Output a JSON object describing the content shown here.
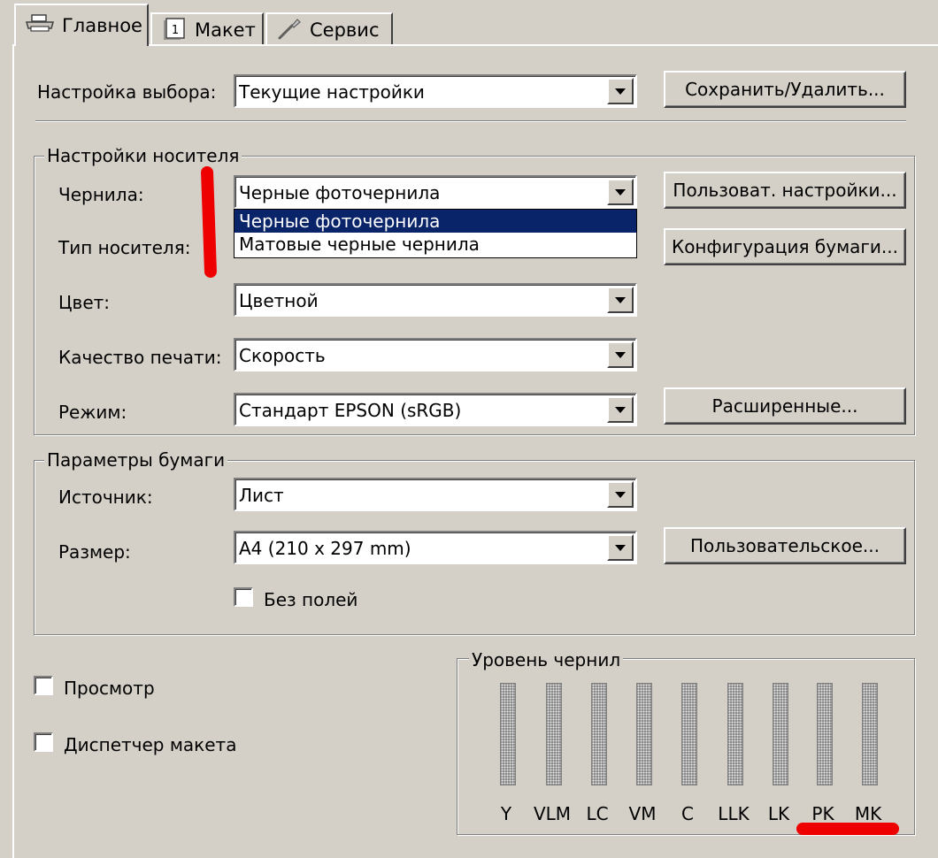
{
  "tabs": [
    {
      "label": "Главное",
      "icon": "printer-icon",
      "active": true
    },
    {
      "label": "Макет",
      "icon": "page-layout-icon",
      "active": false
    },
    {
      "label": "Сервис",
      "icon": "wrench-icon",
      "active": false
    }
  ],
  "preset": {
    "label": "Настройка выбора:",
    "value": "Текущие настройки",
    "save_button": "Сохранить/Удалить..."
  },
  "media_settings": {
    "title": "Настройки носителя",
    "ink_label": "Чернила:",
    "ink_value": "Черные фоточернила",
    "ink_options": [
      "Черные фоточернила",
      "Матовые черные чернила"
    ],
    "ink_selected_index": 0,
    "custom_button": "Пользоват. настройки...",
    "media_type_label": "Тип носителя:",
    "paper_config_button": "Конфигурация бумаги...",
    "color_label": "Цвет:",
    "color_value": "Цветной",
    "quality_label": "Качество печати:",
    "quality_value": "Скорость",
    "mode_label": "Режим:",
    "mode_value": "Стандарт EPSON (sRGB)",
    "advanced_button": "Расширенные..."
  },
  "paper_settings": {
    "title": "Параметры бумаги",
    "source_label": "Источник:",
    "source_value": "Лист",
    "size_label": "Размер:",
    "size_value": "A4 (210 x 297 mm)",
    "user_defined_button": "Пользовательское...",
    "borderless_label": "Без полей",
    "borderless_checked": false
  },
  "options": {
    "preview_label": "Просмотр",
    "preview_checked": false,
    "layout_manager_label": "Диспетчер макета",
    "layout_manager_checked": false
  },
  "ink_levels": {
    "title": "Уровень чернил",
    "inks": [
      "Y",
      "VLM",
      "LC",
      "VM",
      "C",
      "LLK",
      "LK",
      "PK",
      "MK"
    ]
  },
  "colors": {
    "background": "#d4d0c8",
    "selection": "#0a246a",
    "annotation": "#ee0000"
  }
}
